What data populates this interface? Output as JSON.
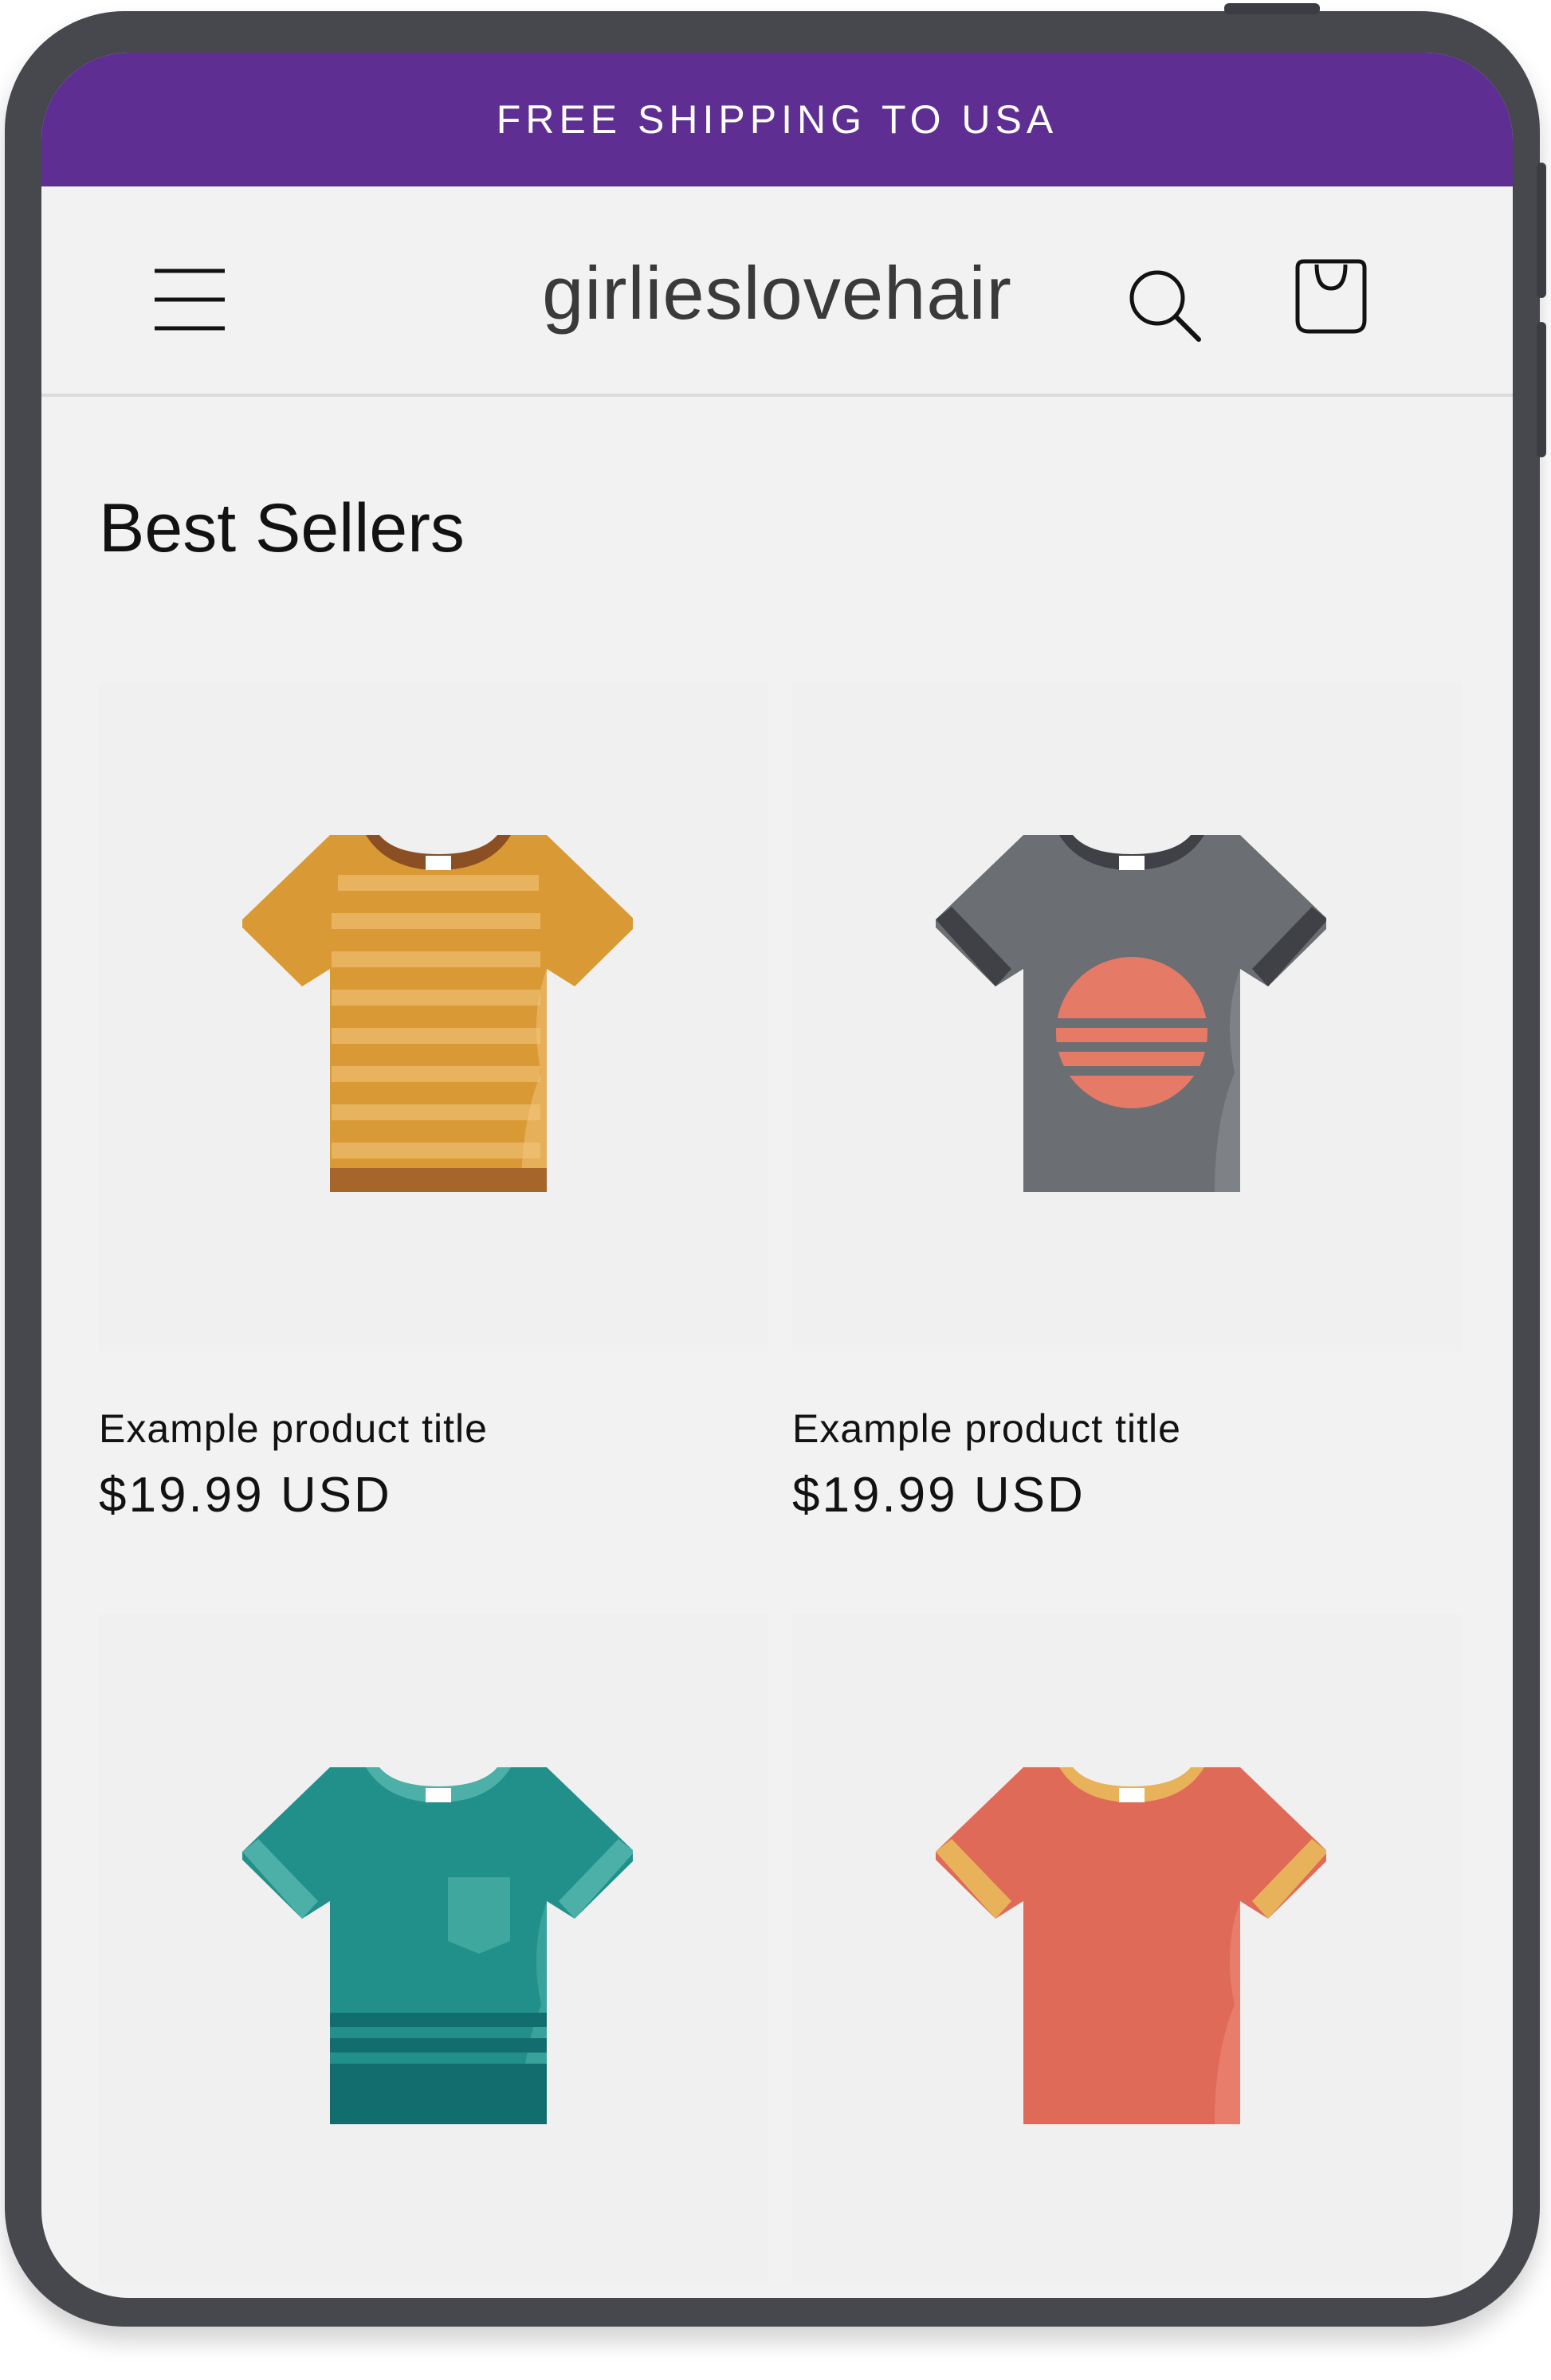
{
  "announcement": {
    "text": "FREE SHIPPING TO USA",
    "background": "#5f2e93"
  },
  "header": {
    "logo_text": "girlieslovehair",
    "icons": [
      "menu-icon",
      "search-icon",
      "cart-icon"
    ]
  },
  "section": {
    "title": "Best Sellers"
  },
  "products": [
    {
      "title": "Example product title",
      "price": "$19.99 USD",
      "image": "striped-orange-tshirt"
    },
    {
      "title": "Example product title",
      "price": "$19.99 USD",
      "image": "gray-sunset-tshirt"
    },
    {
      "title": "",
      "price": "",
      "image": "teal-pocket-tshirt"
    },
    {
      "title": "",
      "price": "",
      "image": "coral-ringer-tshirt"
    }
  ],
  "colors": {
    "accent": "#5f2e93",
    "page_background": "#f2f2f2",
    "device_frame": "#46484d",
    "text": "#121212"
  }
}
